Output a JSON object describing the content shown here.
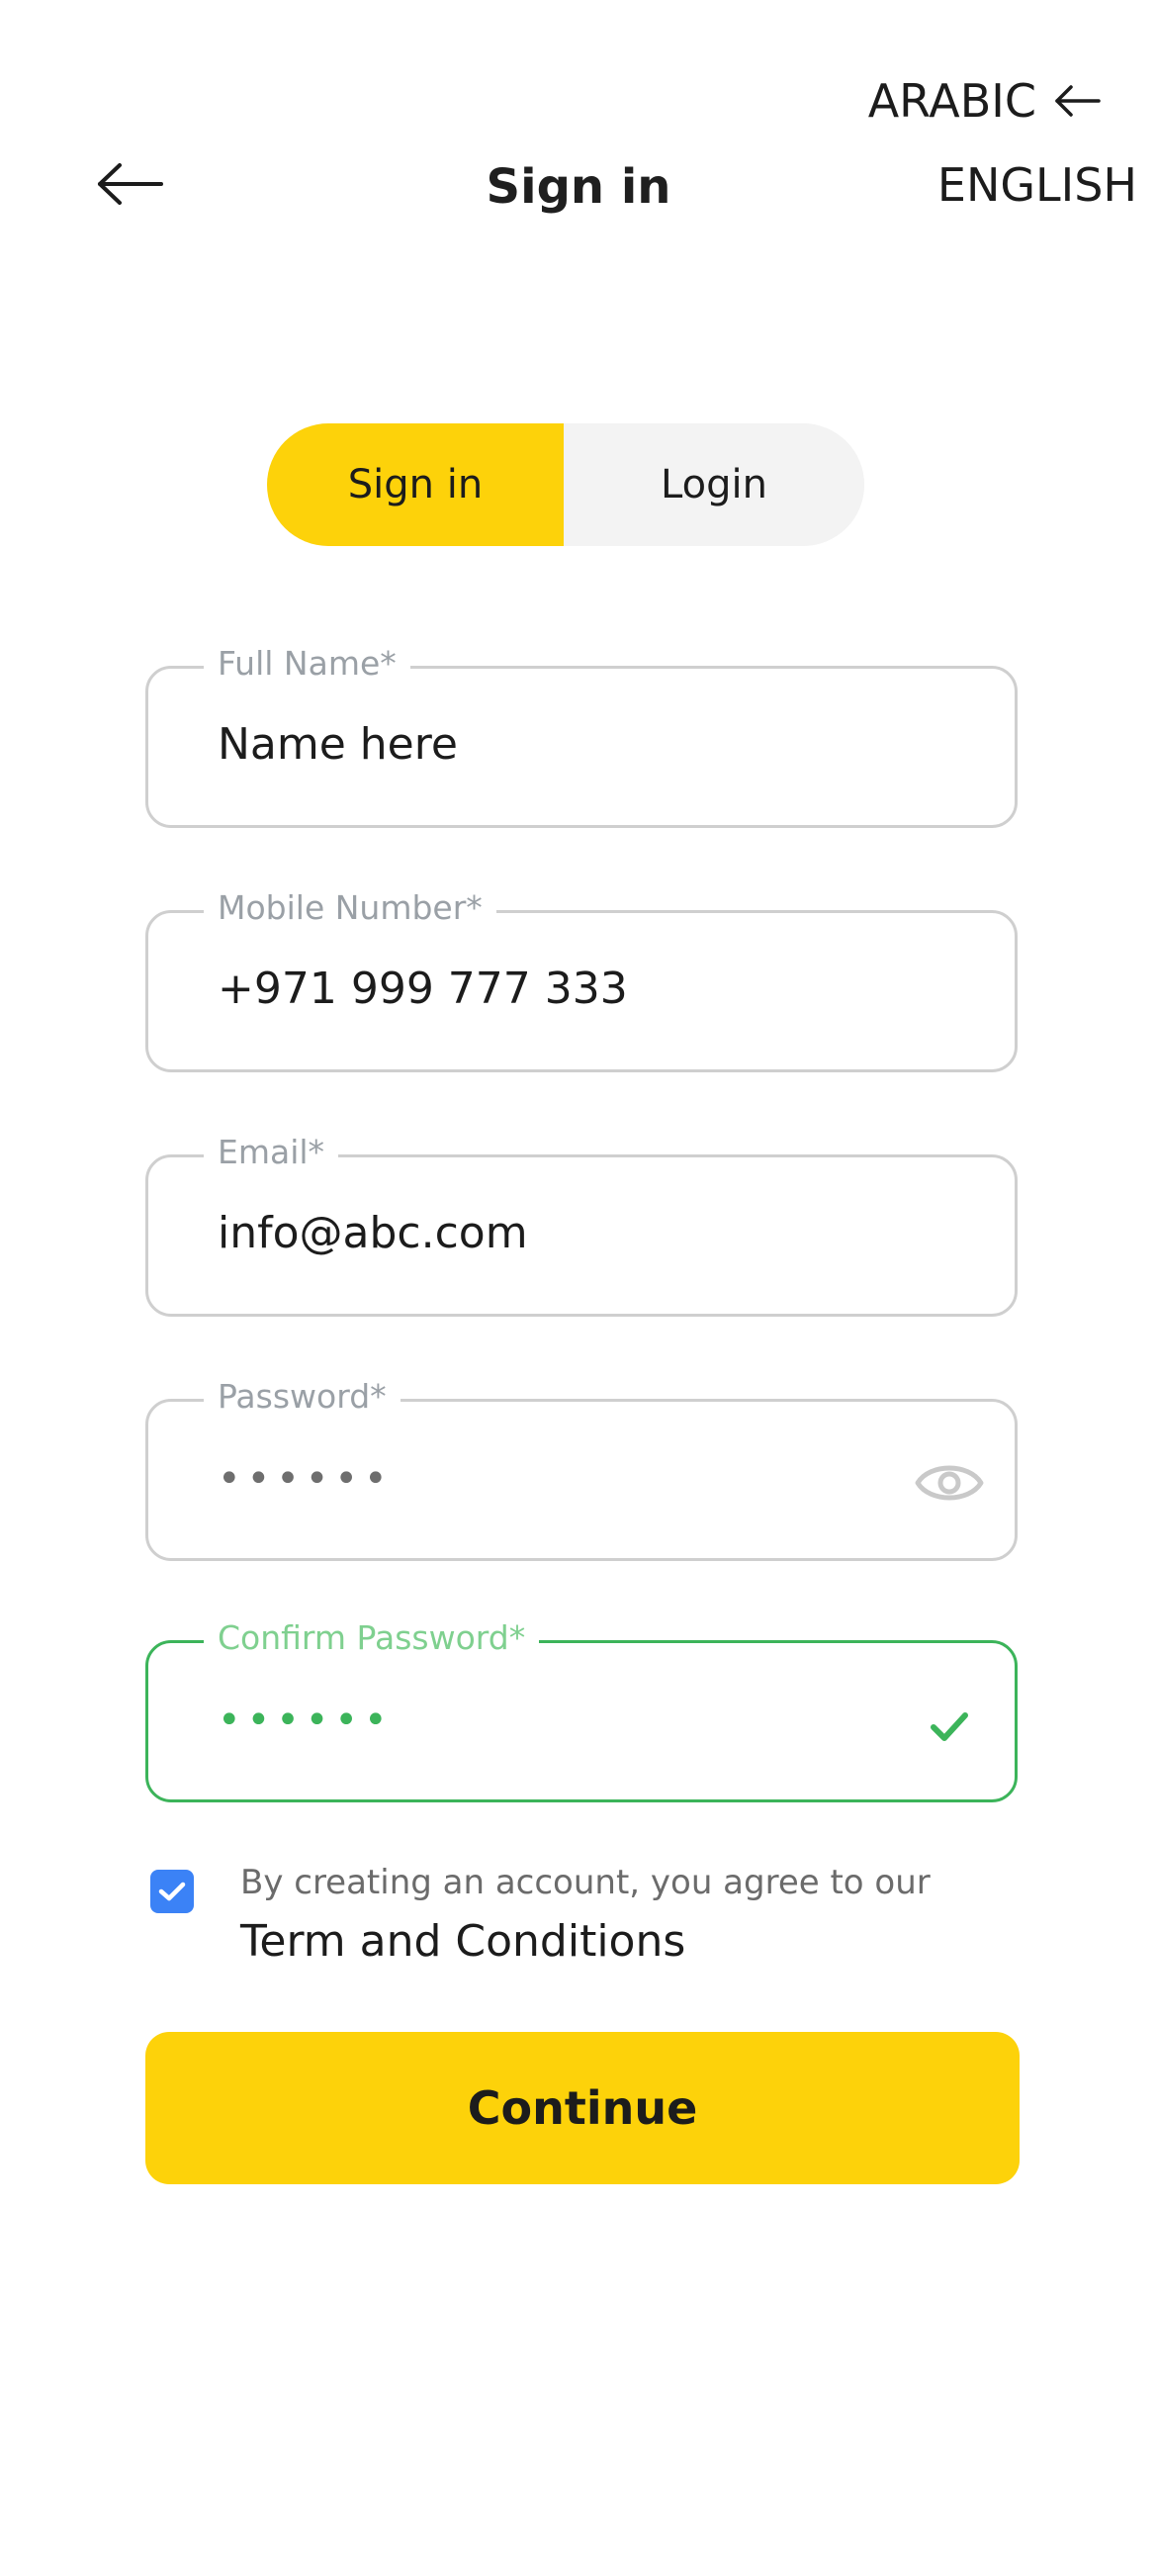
{
  "header": {
    "title": "Sign in",
    "language_options": {
      "arabic": "ARABIC",
      "english": "ENGLISH"
    }
  },
  "tabs": {
    "sign_in": "Sign in",
    "login": "Login",
    "active": "Sign in"
  },
  "form": {
    "full_name": {
      "label": "Full Name*",
      "value": "Name here"
    },
    "mobile": {
      "label": "Mobile Number*",
      "value": "+971 999 777 333"
    },
    "email": {
      "label": "Email*",
      "value": "info@abc.com"
    },
    "password": {
      "label": "Password*",
      "value": "••••••"
    },
    "confirm_password": {
      "label": "Confirm Password*",
      "value": "••••••"
    }
  },
  "terms": {
    "checked": true,
    "text": "By creating an account, you agree to our",
    "link": "Term and Conditions"
  },
  "continue_label": "Continue",
  "colors": {
    "accent_yellow": "#fdd20a",
    "valid_green": "#3cb45a",
    "checkbox_blue": "#3b82f6",
    "tab_inactive_bg": "#f3f3f3"
  },
  "icons": {
    "back": "arrow-left-icon",
    "arabic": "arrow-left-icon",
    "password_toggle": "eye-icon",
    "confirm_valid": "check-icon",
    "checkbox": "check-icon"
  }
}
